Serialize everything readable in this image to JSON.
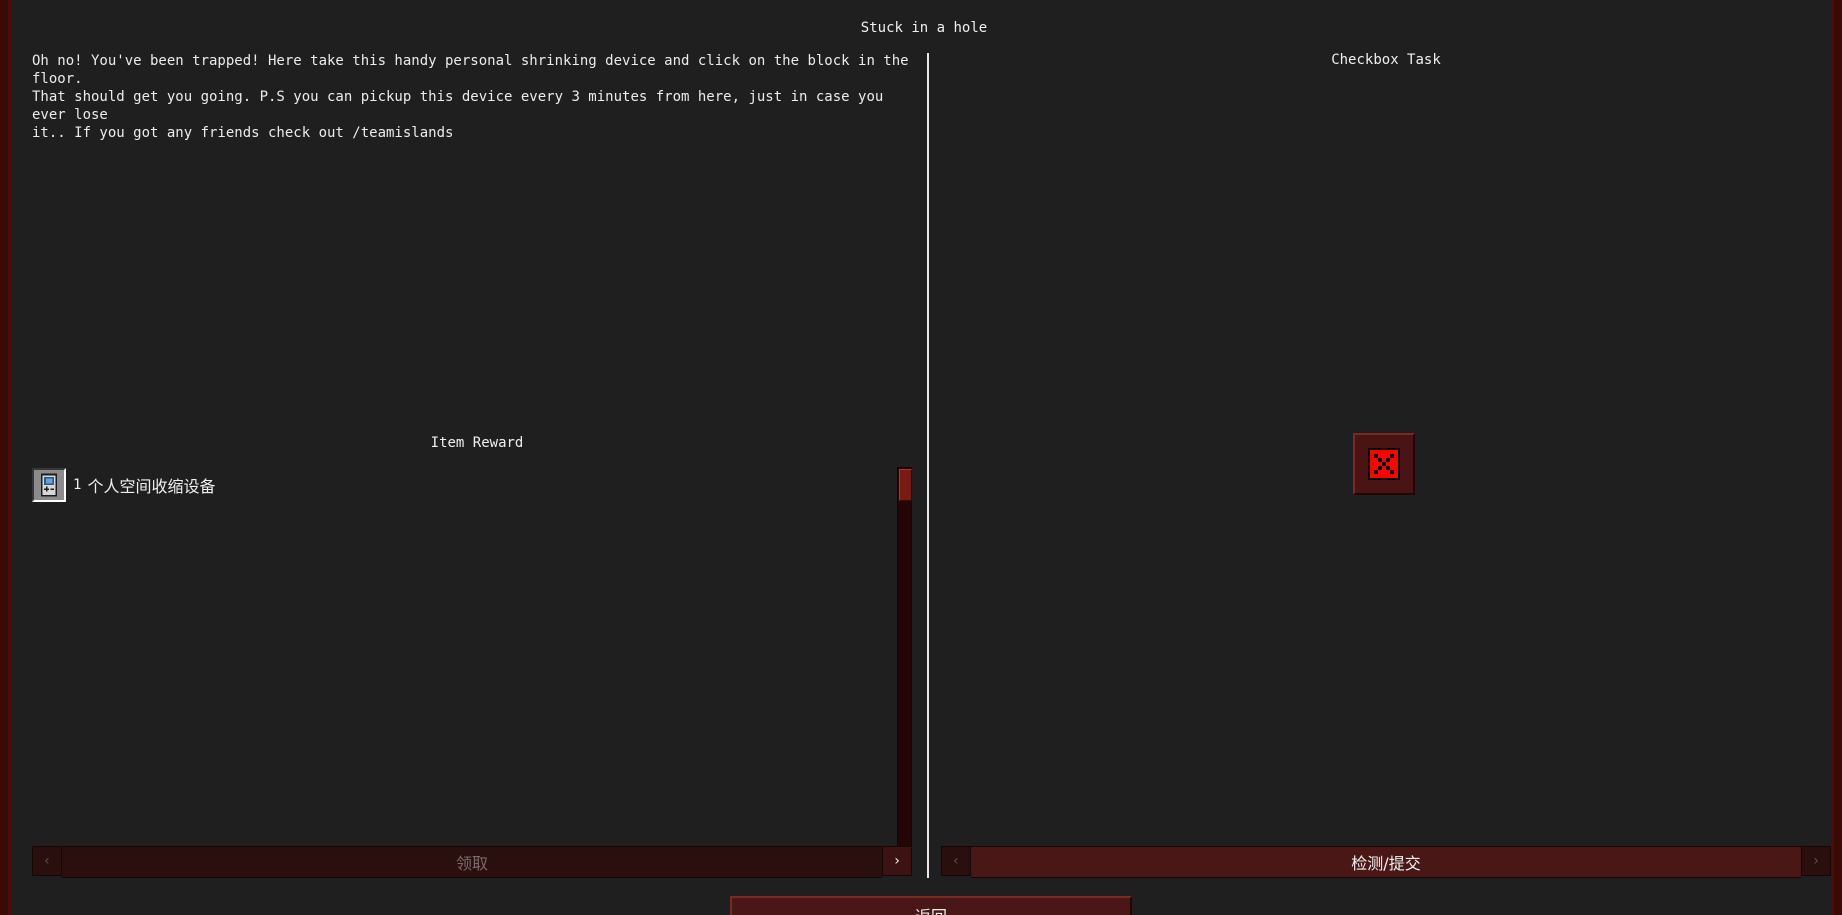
{
  "quest": {
    "title": "Stuck in a hole",
    "description": "Oh no! You've been trapped! Here take this handy personal shrinking device and click on the block in the floor.\nThat should get you going. P.S you can pickup this device every 3 minutes from here, just in case you ever lose\nit.. If you got any friends check out /teamislands"
  },
  "reward": {
    "title": "Item Reward",
    "items": [
      {
        "count": "1",
        "name": "个人空间收缩设备",
        "icon": "handheld-device-icon"
      }
    ],
    "claim_label": "领取",
    "prev_glyph": "‹",
    "next_glyph": "›"
  },
  "task": {
    "title": "Checkbox Task",
    "checkbox_state": "unchecked",
    "checkbox_icon": "red-x-icon",
    "submit_label": "检测/提交",
    "prev_glyph": "‹",
    "next_glyph": "›"
  },
  "footer": {
    "back_label": "返回"
  },
  "colors": {
    "panel_bg": "#1f1f1f",
    "frame_border": "#4a0e08",
    "button_active": "#4a1717",
    "button_disabled": "#2a0f0f",
    "cross_red": "#ff0000"
  }
}
